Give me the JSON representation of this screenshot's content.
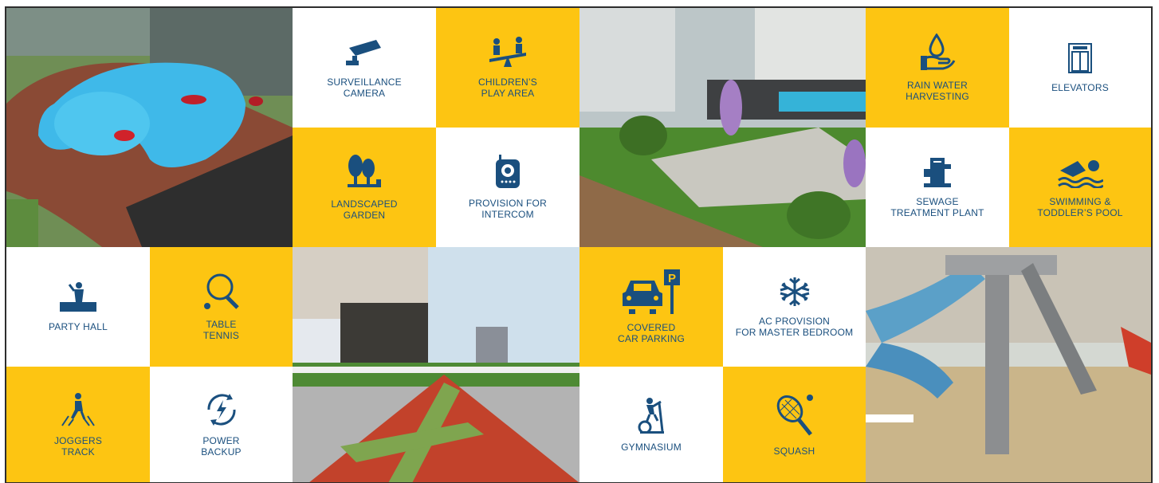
{
  "colors": {
    "yellow": "#fdc512",
    "white": "#ffffff",
    "icon": "#1a4f7e",
    "frame": "#2d2d2d"
  },
  "amenities": [
    {
      "icon": "surveillance-camera-icon",
      "line1": "SURVEILLANCE",
      "line2": "CAMERA"
    },
    {
      "icon": "children-play-area-icon",
      "line1": "CHILDREN’S",
      "line2": "PLAY AREA"
    },
    {
      "icon": "landscaped-garden-icon",
      "line1": "LANDSCAPED",
      "line2": "GARDEN"
    },
    {
      "icon": "intercom-icon",
      "line1": "PROVISION FOR",
      "line2": "INTERCOM"
    },
    {
      "icon": "rain-water-harvesting-icon",
      "line1": "RAIN WATER",
      "line2": "HARVESTING"
    },
    {
      "icon": "elevator-icon",
      "line1": "ELEVATORS",
      "line2": ""
    },
    {
      "icon": "sewage-treatment-icon",
      "line1": "SEWAGE",
      "line2": "TREATMENT PLANT"
    },
    {
      "icon": "swimming-icon",
      "line1": "SWIMMING &",
      "line2": "TODDLER’S POOL"
    },
    {
      "icon": "party-hall-icon",
      "line1": "PARTY HALL",
      "line2": ""
    },
    {
      "icon": "table-tennis-icon",
      "line1": "TABLE",
      "line2": "TENNIS"
    },
    {
      "icon": "joggers-track-icon",
      "line1": "JOGGERS",
      "line2": "TRACK"
    },
    {
      "icon": "power-backup-icon",
      "line1": "POWER",
      "line2": "BACKUP"
    },
    {
      "icon": "car-parking-icon",
      "line1": "COVERED",
      "line2": "CAR PARKING"
    },
    {
      "icon": "snowflake-icon",
      "line1": "AC PROVISION",
      "line2": "FOR MASTER BEDROOM"
    },
    {
      "icon": "gymnasium-icon",
      "line1": "GYMNASIUM",
      "line2": ""
    },
    {
      "icon": "squash-icon",
      "line1": "SQUASH",
      "line2": ""
    }
  ],
  "photos": [
    {
      "icon": "pool-render-photo"
    },
    {
      "icon": "garden-render-photo"
    },
    {
      "icon": "jogging-track-render-photo"
    },
    {
      "icon": "slide-playground-render-photo"
    }
  ]
}
